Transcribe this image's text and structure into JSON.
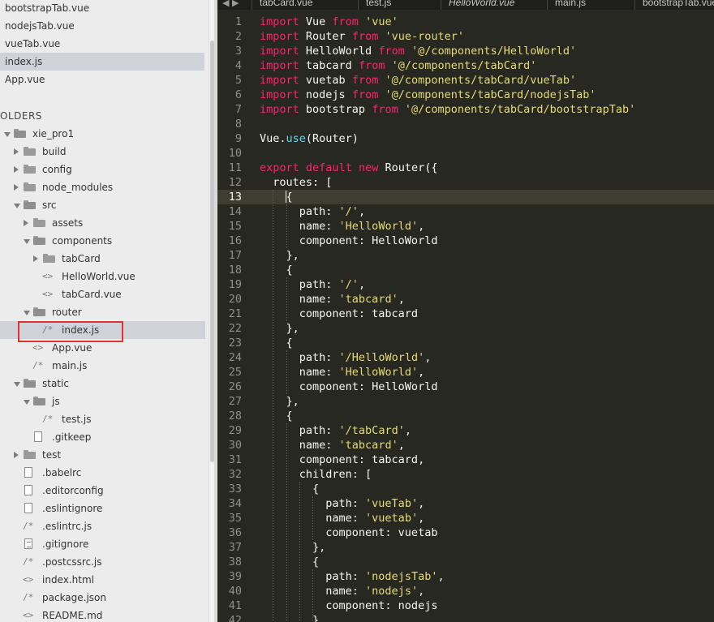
{
  "open_files": [
    {
      "label": "bootstrapTab.vue",
      "active": false
    },
    {
      "label": "nodejsTab.vue",
      "active": false
    },
    {
      "label": "vueTab.vue",
      "active": false
    },
    {
      "label": "index.js",
      "active": true
    },
    {
      "label": "App.vue",
      "active": false
    }
  ],
  "folders_title": "OLDERS",
  "tree": [
    {
      "label": "xie_pro1",
      "type": "folder",
      "expanded": true,
      "depth": 0
    },
    {
      "label": "build",
      "type": "folder",
      "expanded": false,
      "depth": 1
    },
    {
      "label": "config",
      "type": "folder",
      "expanded": false,
      "depth": 1
    },
    {
      "label": "node_modules",
      "type": "folder",
      "expanded": false,
      "depth": 1
    },
    {
      "label": "src",
      "type": "folder",
      "expanded": true,
      "depth": 1
    },
    {
      "label": "assets",
      "type": "folder",
      "expanded": false,
      "depth": 2
    },
    {
      "label": "components",
      "type": "folder",
      "expanded": true,
      "depth": 2
    },
    {
      "label": "tabCard",
      "type": "folder",
      "expanded": false,
      "depth": 3
    },
    {
      "label": "HelloWorld.vue",
      "type": "vue",
      "depth": 3
    },
    {
      "label": "tabCard.vue",
      "type": "vue",
      "depth": 3
    },
    {
      "label": "router",
      "type": "folder",
      "expanded": true,
      "depth": 2
    },
    {
      "label": "index.js",
      "type": "js",
      "depth": 3,
      "selected": true
    },
    {
      "label": "App.vue",
      "type": "vue",
      "depth": 2
    },
    {
      "label": "main.js",
      "type": "js",
      "depth": 2
    },
    {
      "label": "static",
      "type": "folder",
      "expanded": true,
      "depth": 1
    },
    {
      "label": "js",
      "type": "folder",
      "expanded": true,
      "depth": 2
    },
    {
      "label": "test.js",
      "type": "js",
      "depth": 3
    },
    {
      "label": ".gitkeep",
      "type": "doc",
      "depth": 2
    },
    {
      "label": "test",
      "type": "folder",
      "expanded": false,
      "depth": 1
    },
    {
      "label": ".babelrc",
      "type": "doc",
      "depth": 1
    },
    {
      "label": ".editorconfig",
      "type": "doc",
      "depth": 1
    },
    {
      "label": ".eslintignore",
      "type": "doc",
      "depth": 1
    },
    {
      "label": ".eslintrc.js",
      "type": "js",
      "depth": 1
    },
    {
      "label": ".gitignore",
      "type": "list",
      "depth": 1
    },
    {
      "label": ".postcssrc.js",
      "type": "js",
      "depth": 1
    },
    {
      "label": "index.html",
      "type": "vue",
      "depth": 1
    },
    {
      "label": "package.json",
      "type": "js",
      "depth": 1
    },
    {
      "label": "README.md",
      "type": "vue",
      "depth": 1
    }
  ],
  "tabs": [
    {
      "label": "tabCard.vue",
      "italic": false
    },
    {
      "label": "test.js",
      "italic": false
    },
    {
      "label": "HelloWorld.vue",
      "italic": true
    },
    {
      "label": "main.js",
      "italic": false
    },
    {
      "label": "bootstrapTab.vue",
      "italic": false
    }
  ],
  "tab_nav": "◀ ▶",
  "current_line": 13,
  "code": [
    [
      [
        "kw",
        "import"
      ],
      [
        "t",
        " Vue "
      ],
      [
        "kw",
        "from"
      ],
      [
        "t",
        " "
      ],
      [
        "str",
        "'vue'"
      ]
    ],
    [
      [
        "kw",
        "import"
      ],
      [
        "t",
        " Router "
      ],
      [
        "kw",
        "from"
      ],
      [
        "t",
        " "
      ],
      [
        "str",
        "'vue-router'"
      ]
    ],
    [
      [
        "kw",
        "import"
      ],
      [
        "t",
        " HelloWorld "
      ],
      [
        "kw",
        "from"
      ],
      [
        "t",
        " "
      ],
      [
        "str",
        "'@/components/HelloWorld'"
      ]
    ],
    [
      [
        "kw",
        "import"
      ],
      [
        "t",
        " tabcard "
      ],
      [
        "kw",
        "from"
      ],
      [
        "t",
        " "
      ],
      [
        "str",
        "'@/components/tabCard'"
      ]
    ],
    [
      [
        "kw",
        "import"
      ],
      [
        "t",
        " vuetab "
      ],
      [
        "kw",
        "from"
      ],
      [
        "t",
        " "
      ],
      [
        "str",
        "'@/components/tabCard/vueTab'"
      ]
    ],
    [
      [
        "kw",
        "import"
      ],
      [
        "t",
        " nodejs "
      ],
      [
        "kw",
        "from"
      ],
      [
        "t",
        " "
      ],
      [
        "str",
        "'@/components/tabCard/nodejsTab'"
      ]
    ],
    [
      [
        "kw",
        "import"
      ],
      [
        "t",
        " bootstrap "
      ],
      [
        "kw",
        "from"
      ],
      [
        "t",
        " "
      ],
      [
        "str",
        "'@/components/tabCard/bootstrapTab'"
      ]
    ],
    [],
    [
      [
        "t",
        "Vue."
      ],
      [
        "fn",
        "use"
      ],
      [
        "t",
        "(Router)"
      ]
    ],
    [],
    [
      [
        "kw",
        "export"
      ],
      [
        "t",
        " "
      ],
      [
        "kw",
        "default"
      ],
      [
        "t",
        " "
      ],
      [
        "kw",
        "new"
      ],
      [
        "t",
        " Router({"
      ]
    ],
    [
      [
        "t",
        "  routes: ["
      ]
    ],
    [
      [
        "t",
        "    {"
      ]
    ],
    [
      [
        "t",
        "      path: "
      ],
      [
        "str",
        "'/'"
      ],
      [
        "t",
        ","
      ]
    ],
    [
      [
        "t",
        "      name: "
      ],
      [
        "str",
        "'HelloWorld'"
      ],
      [
        "t",
        ","
      ]
    ],
    [
      [
        "t",
        "      component: HelloWorld"
      ]
    ],
    [
      [
        "t",
        "    },"
      ]
    ],
    [
      [
        "t",
        "    {"
      ]
    ],
    [
      [
        "t",
        "      path: "
      ],
      [
        "str",
        "'/'"
      ],
      [
        "t",
        ","
      ]
    ],
    [
      [
        "t",
        "      name: "
      ],
      [
        "str",
        "'tabcard'"
      ],
      [
        "t",
        ","
      ]
    ],
    [
      [
        "t",
        "      component: tabcard"
      ]
    ],
    [
      [
        "t",
        "    },"
      ]
    ],
    [
      [
        "t",
        "    {"
      ]
    ],
    [
      [
        "t",
        "      path: "
      ],
      [
        "str",
        "'/HelloWorld'"
      ],
      [
        "t",
        ","
      ]
    ],
    [
      [
        "t",
        "      name: "
      ],
      [
        "str",
        "'HelloWorld'"
      ],
      [
        "t",
        ","
      ]
    ],
    [
      [
        "t",
        "      component: HelloWorld"
      ]
    ],
    [
      [
        "t",
        "    },"
      ]
    ],
    [
      [
        "t",
        "    {"
      ]
    ],
    [
      [
        "t",
        "      path: "
      ],
      [
        "str",
        "'/tabCard'"
      ],
      [
        "t",
        ","
      ]
    ],
    [
      [
        "t",
        "      name: "
      ],
      [
        "str",
        "'tabcard'"
      ],
      [
        "t",
        ","
      ]
    ],
    [
      [
        "t",
        "      component: tabcard,"
      ]
    ],
    [
      [
        "t",
        "      children: ["
      ]
    ],
    [
      [
        "t",
        "        {"
      ]
    ],
    [
      [
        "t",
        "          path: "
      ],
      [
        "str",
        "'vueTab'"
      ],
      [
        "t",
        ","
      ]
    ],
    [
      [
        "t",
        "          name: "
      ],
      [
        "str",
        "'vuetab'"
      ],
      [
        "t",
        ","
      ]
    ],
    [
      [
        "t",
        "          component: vuetab"
      ]
    ],
    [
      [
        "t",
        "        },"
      ]
    ],
    [
      [
        "t",
        "        {"
      ]
    ],
    [
      [
        "t",
        "          path: "
      ],
      [
        "str",
        "'nodejsTab'"
      ],
      [
        "t",
        ","
      ]
    ],
    [
      [
        "t",
        "          name: "
      ],
      [
        "str",
        "'nodejs'"
      ],
      [
        "t",
        ","
      ]
    ],
    [
      [
        "t",
        "          component: nodejs"
      ]
    ],
    [
      [
        "t",
        "        }"
      ]
    ]
  ],
  "colors": {
    "editor_bg": "#272822",
    "keyword": "#f92672",
    "string": "#e6db74",
    "function": "#66d9ef",
    "selection_box": "#e0312a"
  }
}
